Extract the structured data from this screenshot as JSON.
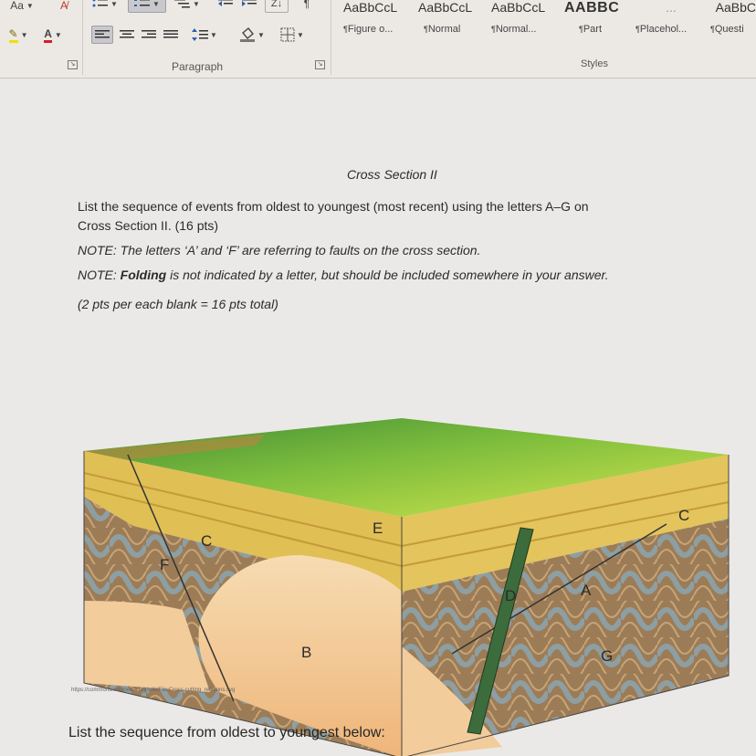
{
  "ribbon": {
    "font": {
      "font_case_label": "Aa",
      "clear_format_glyph": "A̸",
      "highlight_label": "✎",
      "font_color_label": "A"
    },
    "paragraph": {
      "group_label": "Paragraph",
      "sort_label": "Z↓",
      "pilcrow_label": "¶"
    },
    "styles": {
      "group_label": "Styles",
      "more_label": "...",
      "items": [
        {
          "preview": "AaBbCcL",
          "name": "Figure o..."
        },
        {
          "preview": "AaBbCcL",
          "name": "Normal"
        },
        {
          "preview": "AaBbCcL",
          "name": "Normal..."
        },
        {
          "preview": "AABBC",
          "name": "Part"
        },
        {
          "preview": "",
          "name": "Placehol..."
        },
        {
          "preview": "AaBbC",
          "name": "Questi"
        }
      ]
    }
  },
  "document": {
    "heading": "Cross Section II",
    "instruction_line1": "List the sequence of events from oldest to youngest (most recent) using the letters A–G on",
    "instruction_line2": "Cross Section II. (16 pts)",
    "note1": "NOTE: The letters ‘A’ and ‘F’ are referring to faults on the cross section.",
    "note2_prefix": "NOTE: ",
    "note2_bold": "Folding",
    "note2_suffix": " is not indicated by a letter, but should be included somewhere in your answer.",
    "points_note": "(2 pts per each blank = 16 pts total)",
    "figure_credit": "https://commons.wikimedia.org/wiki/File:Cross-cutting_relations.svg",
    "figure_labels": {
      "A": "A",
      "B": "B",
      "C_left": "C",
      "C_right": "C",
      "D": "D",
      "E": "E",
      "F": "F",
      "G": "G"
    },
    "answer_prompt": "List the sequence from oldest to youngest below:"
  },
  "colors": {
    "grass_light": "#c9e04a",
    "grass_dark": "#4f9a3a",
    "sandstone": "#e0bf55",
    "fold_brown": "#9a7a55",
    "fold_gray": "#8e9ea2",
    "granite": "#f2c796",
    "dike": "#3c6b3c"
  }
}
